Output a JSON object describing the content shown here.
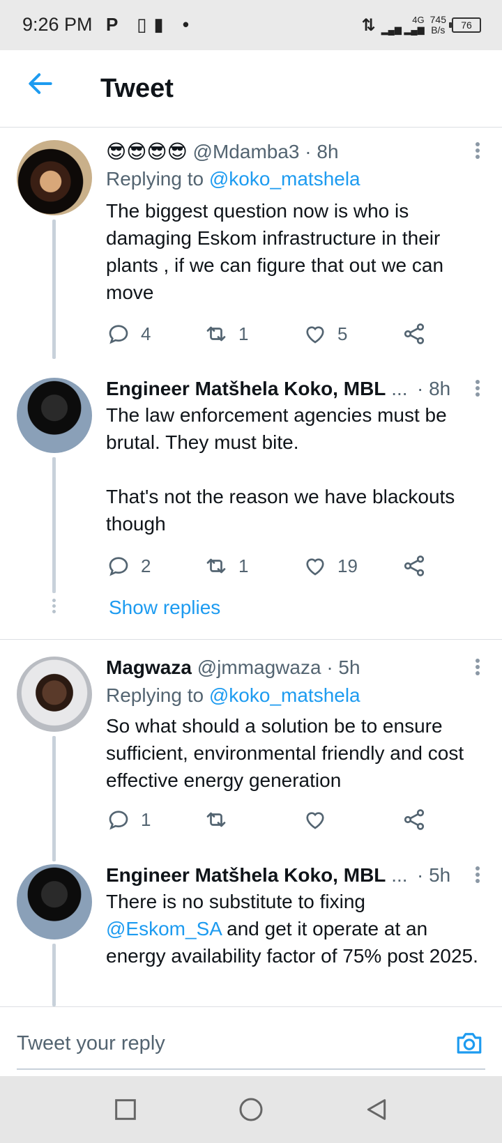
{
  "status_bar": {
    "time": "9:26 PM",
    "notif_icons": "P ▯▮ •",
    "network": "⇅",
    "net_type": "4G",
    "speed_top": "745",
    "speed_bottom": "B/s",
    "battery": "76"
  },
  "header": {
    "title": "Tweet",
    "back_icon": "arrow-left-icon"
  },
  "tweets": [
    {
      "name": "😎😎😎😎",
      "handle": "@Mdamba3",
      "time": "· 8h",
      "replying_prefix": "Replying to",
      "replying_handle": "@koko_matshela",
      "text": "The biggest question now is who is damaging Eskom infrastructure in their plants , if we can figure that out we can move",
      "replies": "4",
      "retweets": "1",
      "likes": "5"
    },
    {
      "name": "Engineer Matšhela Koko, MBL",
      "truncation": "...",
      "time": "· 8h",
      "text_line1": "The law enforcement agencies must be brutal. They must bite.",
      "text_line2": "That's not the reason we have blackouts though",
      "replies": "2",
      "retweets": "1",
      "likes": "19"
    },
    {
      "name": "Magwaza",
      "handle": "@jmmagwaza",
      "time": "· 5h",
      "replying_prefix": "Replying to",
      "replying_handle": "@koko_matshela",
      "text": "So what should a solution be to ensure sufficient, environmental  friendly and cost effective energy generation",
      "replies": "1"
    },
    {
      "name": "Engineer Matšhela Koko, MBL",
      "truncation": "...",
      "time": "· 5h",
      "text_before": "There is no substitute to fixing",
      "mention": "@Eskom_SA",
      "text_after": " and get it operate at an energy availability factor of 75% post 2025."
    }
  ],
  "show_replies": "Show replies",
  "reply_bar": {
    "placeholder": "Tweet your reply"
  },
  "colors": {
    "accent": "#1d9bf0",
    "text": "#0f1419",
    "muted": "#536471"
  }
}
